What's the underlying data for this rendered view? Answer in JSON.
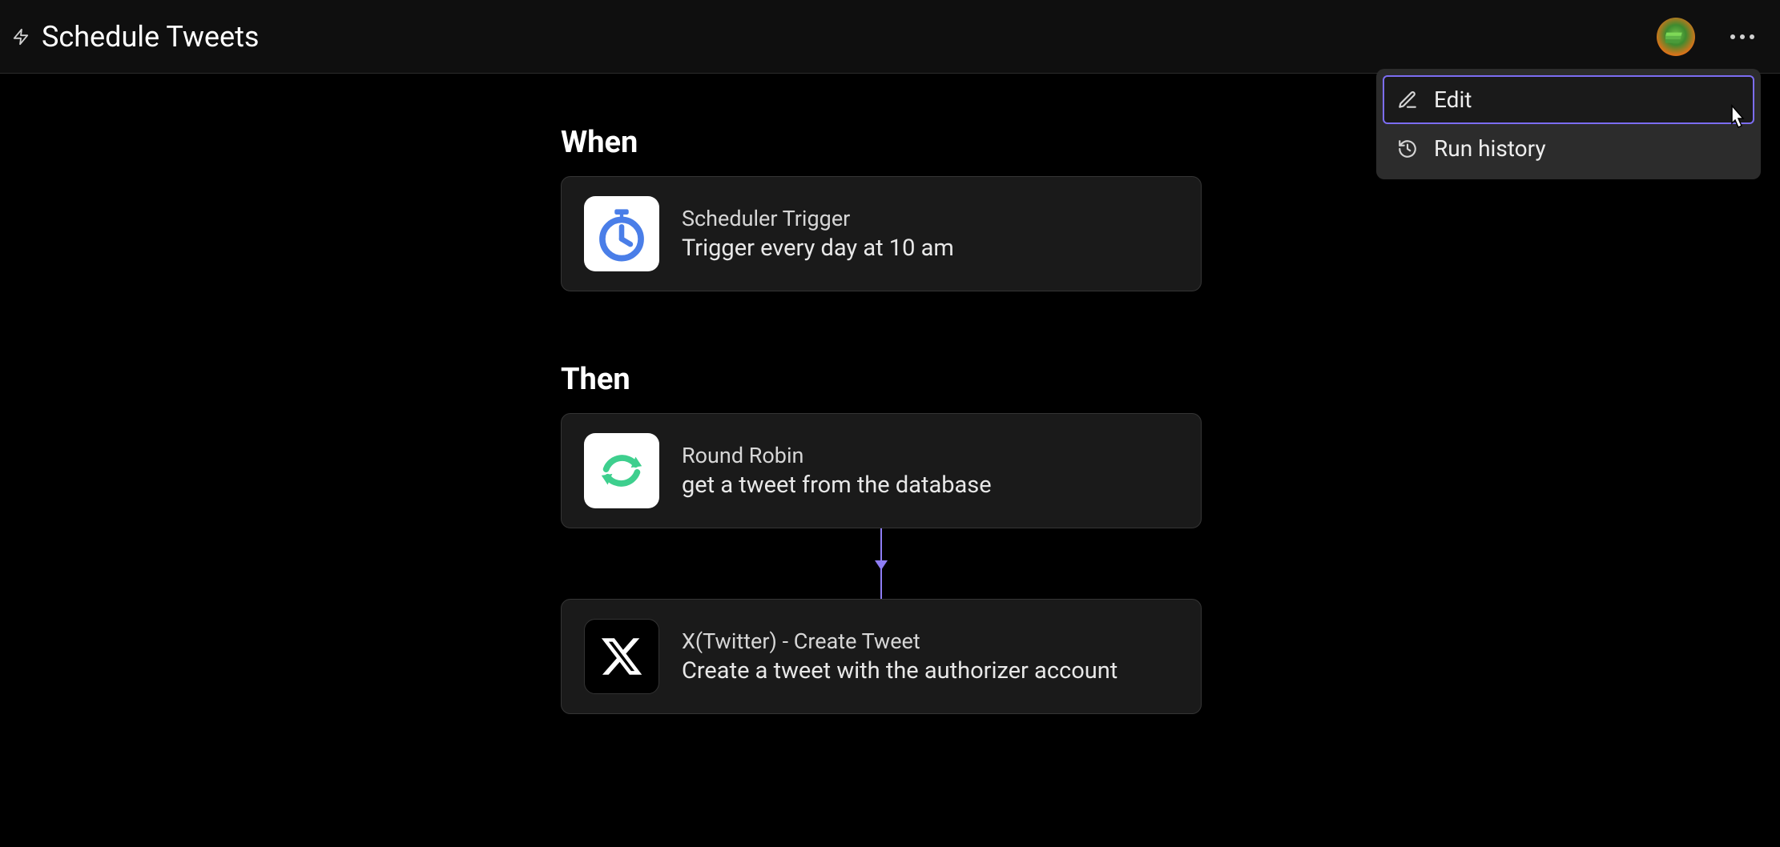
{
  "header": {
    "title": "Schedule Tweets"
  },
  "menu": {
    "edit": "Edit",
    "run_history": "Run history"
  },
  "flow": {
    "when_label": "When",
    "then_label": "Then",
    "trigger": {
      "title": "Scheduler Trigger",
      "desc": "Trigger every day at 10 am"
    },
    "step1": {
      "title": "Round Robin",
      "desc": "get a tweet from the database"
    },
    "step2": {
      "title": "X(Twitter) - Create Tweet",
      "desc": "Create a tweet with the authorizer account"
    }
  }
}
